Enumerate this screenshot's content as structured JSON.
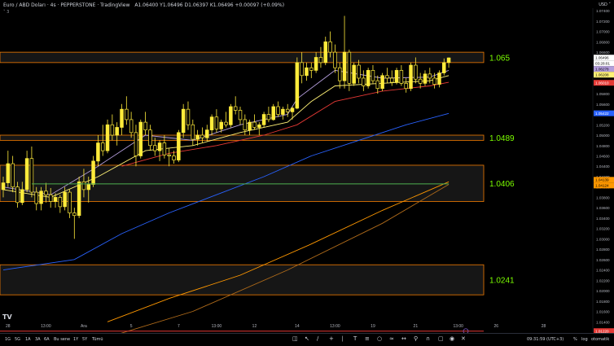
{
  "header": {
    "symbol": "Euro / ABD Doları · 4s · PEPPERSTONE · TradingView",
    "ohlc": "A1.06400  Y1.06496  D1.06397  K1.06496 +0.00097 (+0.09%)",
    "indicators_toggle": "˅ 3"
  },
  "currency": "USD ˅",
  "chart_data": {
    "type": "candlestick",
    "ylim": [
      1.012,
      1.0745
    ],
    "price_ticks": [
      "1.07400",
      "1.07200",
      "1.07000",
      "1.06800",
      "1.06600",
      "1.06400",
      "1.06200",
      "1.06000",
      "1.05800",
      "1.05600",
      "1.05400",
      "1.05200",
      "1.05000",
      "1.04800",
      "1.04600",
      "1.04400",
      "1.04200",
      "1.04000",
      "1.03800",
      "1.03600",
      "1.03400",
      "1.03200",
      "1.03000",
      "1.02800",
      "1.02600",
      "1.02400",
      "1.02200",
      "1.02000",
      "1.01800",
      "1.01600",
      "1.01400",
      "1.01200"
    ],
    "time_labels": [
      {
        "i": 1,
        "label": "28"
      },
      {
        "i": 9,
        "label": "13:00"
      },
      {
        "i": 17,
        "label": "Ara"
      },
      {
        "i": 27,
        "label": "5"
      },
      {
        "i": 37,
        "label": "7"
      },
      {
        "i": 45,
        "label": "13:00"
      },
      {
        "i": 53,
        "label": "12"
      },
      {
        "i": 62,
        "label": "14"
      },
      {
        "i": 70,
        "label": "13:00"
      },
      {
        "i": 78,
        "label": "19"
      },
      {
        "i": 87,
        "label": "21"
      },
      {
        "i": 96,
        "label": "13:00"
      },
      {
        "i": 104,
        "label": "26"
      },
      {
        "i": 114,
        "label": "28"
      }
    ],
    "candles": [
      [
        1.0395,
        1.042,
        1.038,
        1.0408
      ],
      [
        1.0408,
        1.047,
        1.04,
        1.0445
      ],
      [
        1.0445,
        1.046,
        1.039,
        1.04
      ],
      [
        1.04,
        1.041,
        1.036,
        1.037
      ],
      [
        1.037,
        1.041,
        1.0365,
        1.0395
      ],
      [
        1.0395,
        1.047,
        1.039,
        1.0455
      ],
      [
        1.0455,
        1.0478,
        1.038,
        1.039
      ],
      [
        1.039,
        1.04,
        1.0355,
        1.0368
      ],
      [
        1.0368,
        1.04,
        1.0355,
        1.0392
      ],
      [
        1.0392,
        1.0408,
        1.037,
        1.0385
      ],
      [
        1.0385,
        1.0398,
        1.036,
        1.0372
      ],
      [
        1.0372,
        1.0388,
        1.036,
        1.038
      ],
      [
        1.038,
        1.0385,
        1.035,
        1.0362
      ],
      [
        1.0362,
        1.04,
        1.0355,
        1.039
      ],
      [
        1.039,
        1.0395,
        1.034,
        1.035
      ],
      [
        1.035,
        1.036,
        1.03,
        1.0345
      ],
      [
        1.0345,
        1.042,
        1.034,
        1.041
      ],
      [
        1.041,
        1.0435,
        1.038,
        1.0395
      ],
      [
        1.0395,
        1.042,
        1.037,
        1.0405
      ],
      [
        1.0405,
        1.046,
        1.04,
        1.045
      ],
      [
        1.045,
        1.05,
        1.044,
        1.0485
      ],
      [
        1.0485,
        1.052,
        1.046,
        1.047
      ],
      [
        1.047,
        1.053,
        1.0465,
        1.052
      ],
      [
        1.052,
        1.054,
        1.049,
        1.05
      ],
      [
        1.05,
        1.0525,
        1.048,
        1.0515
      ],
      [
        1.0515,
        1.056,
        1.05,
        1.055
      ],
      [
        1.055,
        1.0575,
        1.052,
        1.053
      ],
      [
        1.053,
        1.0545,
        1.0495,
        1.0505
      ],
      [
        1.0505,
        1.052,
        1.044,
        1.046
      ],
      [
        1.046,
        1.053,
        1.0455,
        1.0525
      ],
      [
        1.0525,
        1.0545,
        1.05,
        1.051
      ],
      [
        1.051,
        1.052,
        1.047,
        1.048
      ],
      [
        1.048,
        1.0495,
        1.046,
        1.047
      ],
      [
        1.047,
        1.049,
        1.045,
        1.0485
      ],
      [
        1.0485,
        1.05,
        1.0455,
        1.0462
      ],
      [
        1.0462,
        1.0475,
        1.044,
        1.046
      ],
      [
        1.046,
        1.047,
        1.0445,
        1.0452
      ],
      [
        1.0452,
        1.051,
        1.0448,
        1.0505
      ],
      [
        1.0505,
        1.056,
        1.0495,
        1.055
      ],
      [
        1.055,
        1.0565,
        1.051,
        1.052
      ],
      [
        1.052,
        1.053,
        1.048,
        1.0492
      ],
      [
        1.0492,
        1.051,
        1.048,
        1.05
      ],
      [
        1.05,
        1.0515,
        1.0485,
        1.0495
      ],
      [
        1.0495,
        1.052,
        1.0488,
        1.051
      ],
      [
        1.051,
        1.054,
        1.05,
        1.0535
      ],
      [
        1.0535,
        1.055,
        1.0505,
        1.0512
      ],
      [
        1.0512,
        1.053,
        1.0505,
        1.0525
      ],
      [
        1.0525,
        1.0545,
        1.0515,
        1.052
      ],
      [
        1.052,
        1.056,
        1.0515,
        1.0555
      ],
      [
        1.0555,
        1.0575,
        1.054,
        1.0548
      ],
      [
        1.0548,
        1.0555,
        1.052,
        1.053
      ],
      [
        1.053,
        1.054,
        1.05,
        1.051
      ],
      [
        1.051,
        1.053,
        1.05,
        1.0525
      ],
      [
        1.0525,
        1.054,
        1.051,
        1.0515
      ],
      [
        1.0515,
        1.0525,
        1.05,
        1.052
      ],
      [
        1.052,
        1.0545,
        1.0515,
        1.054
      ],
      [
        1.054,
        1.0555,
        1.0525,
        1.053
      ],
      [
        1.053,
        1.056,
        1.0528,
        1.0555
      ],
      [
        1.0555,
        1.0565,
        1.0535,
        1.054
      ],
      [
        1.054,
        1.0555,
        1.053,
        1.055
      ],
      [
        1.055,
        1.056,
        1.0535,
        1.0545
      ],
      [
        1.0545,
        1.0555,
        1.053,
        1.0552
      ],
      [
        1.0552,
        1.065,
        1.055,
        1.064
      ],
      [
        1.064,
        1.066,
        1.06,
        1.0615
      ],
      [
        1.0615,
        1.064,
        1.0605,
        1.063
      ],
      [
        1.063,
        1.064,
        1.061,
        1.0625
      ],
      [
        1.0625,
        1.066,
        1.062,
        1.065
      ],
      [
        1.065,
        1.067,
        1.063,
        1.064
      ],
      [
        1.064,
        1.069,
        1.0635,
        1.068
      ],
      [
        1.068,
        1.07,
        1.065,
        1.066
      ],
      [
        1.066,
        1.0675,
        1.062,
        1.063
      ],
      [
        1.063,
        1.064,
        1.059,
        1.0605
      ],
      [
        1.0605,
        1.073,
        1.059,
        1.066
      ],
      [
        1.066,
        1.0665,
        1.0585,
        1.06
      ],
      [
        1.06,
        1.064,
        1.0595,
        1.0635
      ],
      [
        1.0635,
        1.0645,
        1.06,
        1.061
      ],
      [
        1.061,
        1.0625,
        1.0585,
        1.0595
      ],
      [
        1.0595,
        1.063,
        1.059,
        1.0625
      ],
      [
        1.0625,
        1.0635,
        1.06,
        1.0605
      ],
      [
        1.0605,
        1.0615,
        1.058,
        1.059
      ],
      [
        1.059,
        1.062,
        1.0585,
        1.0615
      ],
      [
        1.0615,
        1.063,
        1.06,
        1.061
      ],
      [
        1.061,
        1.0625,
        1.0595,
        1.0602
      ],
      [
        1.0602,
        1.063,
        1.0598,
        1.0625
      ],
      [
        1.0625,
        1.0635,
        1.0595,
        1.06
      ],
      [
        1.06,
        1.061,
        1.0582,
        1.059
      ],
      [
        1.059,
        1.064,
        1.0585,
        1.0635
      ],
      [
        1.0635,
        1.065,
        1.06,
        1.0608
      ],
      [
        1.0608,
        1.062,
        1.059,
        1.06
      ],
      [
        1.06,
        1.0625,
        1.0595,
        1.0618
      ],
      [
        1.0618,
        1.063,
        1.06,
        1.061
      ],
      [
        1.061,
        1.062,
        1.059,
        1.0598
      ],
      [
        1.0598,
        1.0625,
        1.0592,
        1.062
      ],
      [
        1.062,
        1.0648,
        1.0615,
        1.064
      ],
      [
        1.064,
        1.065,
        1.063,
        1.0649
      ]
    ],
    "moving_averages": [
      {
        "name": "MA1",
        "color": "#b39ddb",
        "points": [
          [
            0,
            1.04
          ],
          [
            10,
            1.0385
          ],
          [
            20,
            1.044
          ],
          [
            30,
            1.05
          ],
          [
            40,
            1.049
          ],
          [
            50,
            1.052
          ],
          [
            60,
            1.054
          ],
          [
            62,
            1.057
          ],
          [
            70,
            1.0625
          ],
          [
            80,
            1.061
          ],
          [
            90,
            1.0612
          ],
          [
            94,
            1.0625
          ]
        ]
      },
      {
        "name": "MA2",
        "color": "#fff176",
        "points": [
          [
            0,
            1.0395
          ],
          [
            10,
            1.038
          ],
          [
            20,
            1.042
          ],
          [
            30,
            1.047
          ],
          [
            40,
            1.048
          ],
          [
            50,
            1.0505
          ],
          [
            60,
            1.0525
          ],
          [
            65,
            1.0565
          ],
          [
            70,
            1.0595
          ],
          [
            80,
            1.06
          ],
          [
            90,
            1.0605
          ],
          [
            94,
            1.0615
          ]
        ]
      },
      {
        "name": "MA3",
        "color": "#e53935",
        "points": [
          [
            25,
            1.044
          ],
          [
            35,
            1.0465
          ],
          [
            45,
            1.048
          ],
          [
            55,
            1.05
          ],
          [
            62,
            1.052
          ],
          [
            70,
            1.0565
          ],
          [
            80,
            1.0585
          ],
          [
            90,
            1.0595
          ],
          [
            94,
            1.0602
          ]
        ]
      },
      {
        "name": "MA4",
        "color": "#2962ff",
        "points": [
          [
            0,
            1.024
          ],
          [
            15,
            1.026
          ],
          [
            25,
            1.031
          ],
          [
            35,
            1.035
          ],
          [
            45,
            1.0385
          ],
          [
            55,
            1.042
          ],
          [
            65,
            1.046
          ],
          [
            75,
            1.049
          ],
          [
            85,
            1.052
          ],
          [
            94,
            1.0542
          ]
        ]
      },
      {
        "name": "MA5",
        "color": "#ff9800",
        "points": [
          [
            22,
            1.014
          ],
          [
            35,
            1.0185
          ],
          [
            50,
            1.023
          ],
          [
            65,
            1.029
          ],
          [
            80,
            1.0355
          ],
          [
            94,
            1.041
          ]
        ]
      },
      {
        "name": "MA6",
        "color": "#b06b1a",
        "points": [
          [
            22,
            1.011
          ],
          [
            40,
            1.016
          ],
          [
            60,
            1.024
          ],
          [
            80,
            1.033
          ],
          [
            94,
            1.0405
          ]
        ]
      }
    ],
    "zones": [
      {
        "top": 1.066,
        "bottom": 1.064,
        "label": "1.065"
      },
      {
        "top": 1.05,
        "bottom": 1.049,
        "label": "1.0489"
      },
      {
        "top": 1.0442,
        "bottom": 1.0372,
        "label": "1.0406"
      },
      {
        "top": 1.025,
        "bottom": 1.0192,
        "label": "1.0241"
      }
    ],
    "green_line": {
      "price": 1.0406,
      "from": 6,
      "to": 94
    },
    "red_line": {
      "price": 1.0122
    },
    "price_tags": [
      {
        "value": "1.06496",
        "color": "#ffffff",
        "text": "#000000"
      },
      {
        "value": "03:28:01",
        "color": "#ffffff",
        "text": "#000000"
      },
      {
        "value": "1.06278",
        "color": "#b39ddb",
        "text": "#000000"
      },
      {
        "value": "1.06208",
        "color": "#fff176",
        "text": "#000000"
      },
      {
        "value": "1.06010",
        "color": "#e53935",
        "text": "#ffffff"
      },
      {
        "value": "1.05422",
        "color": "#2962ff",
        "text": "#ffffff"
      },
      {
        "value": "1.04139",
        "color": "#ff9800",
        "text": "#000000"
      },
      {
        "value": "1.04124",
        "color": "#ff9800",
        "text": "#000000"
      },
      {
        "value": "1.01220",
        "color": "#e53935",
        "text": "#ffffff"
      }
    ]
  },
  "toolbar": {
    "timeframes": [
      "1G",
      "5G",
      "1A",
      "3A",
      "6A",
      "Bu sene",
      "1Y",
      "5Y",
      "Tümü"
    ],
    "clock": "09:31:59 (UTC+3)",
    "percent": "%",
    "log": "log",
    "auto": "otomatik"
  },
  "colors": {
    "bg": "#000000",
    "candle": "#ffeb3b",
    "zone_border": "#f57c00",
    "zone_fill": "#161616",
    "zone_label": "#7cff00",
    "green_line": "#4caf50"
  }
}
